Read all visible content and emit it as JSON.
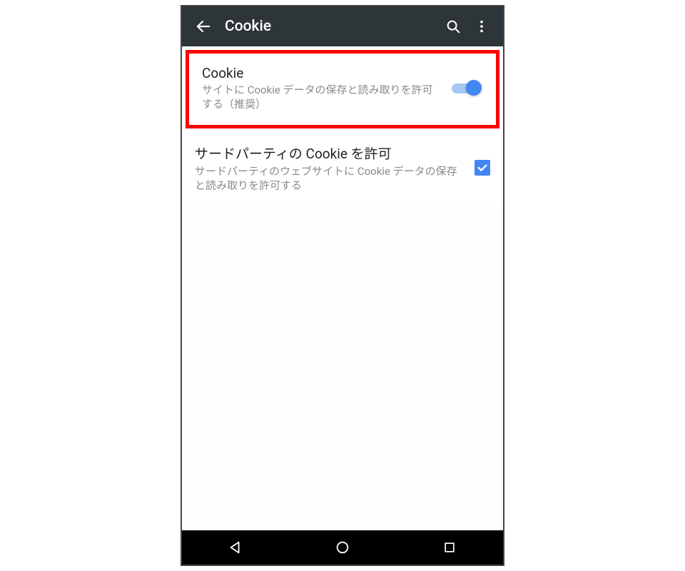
{
  "appbar": {
    "title": "Cookie"
  },
  "settings": {
    "cookie": {
      "title": "Cookie",
      "desc": "サイトに Cookie データの保存と読み取りを許可する（推奨）",
      "enabled": true
    },
    "thirdparty": {
      "title": "サードパーティの Cookie を許可",
      "desc": "サードパーティのウェブサイトに Cookie データの保存と読み取りを許可する",
      "checked": true
    }
  }
}
